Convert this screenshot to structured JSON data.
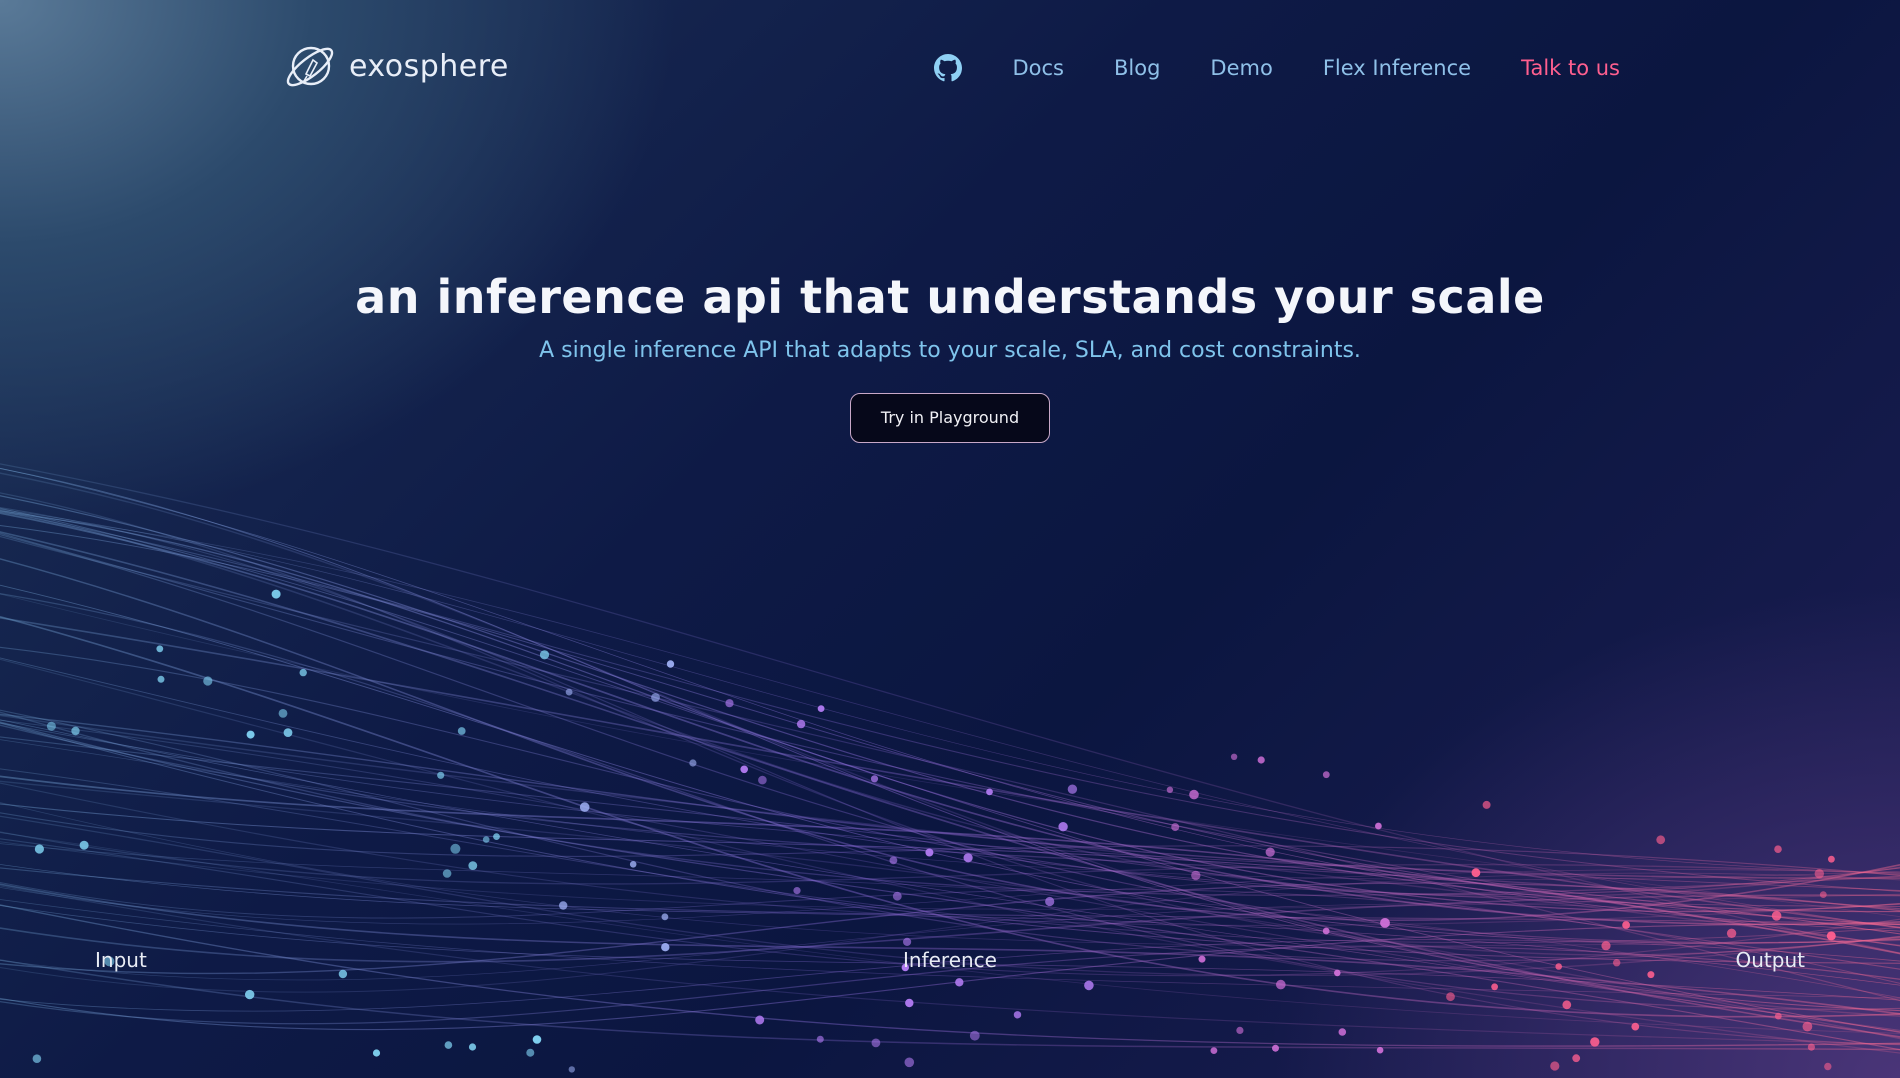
{
  "brand": {
    "name": "exosphere",
    "logo_icon": "planet-rocket-logo-icon"
  },
  "nav": {
    "github_icon": "github-icon",
    "items": [
      {
        "label": "Docs"
      },
      {
        "label": "Blog"
      },
      {
        "label": "Demo"
      },
      {
        "label": "Flex Inference"
      }
    ],
    "cta": "Talk to us"
  },
  "hero": {
    "title": "an inference api that understands your scale",
    "subtitle": "A single inference API that adapts to your scale, SLA, and cost constraints.",
    "button": "Try in Playground"
  },
  "stages": {
    "input": "Input",
    "inference": "Inference",
    "output": "Output"
  },
  "colors": {
    "accent_cyan": "#7fd0f0",
    "accent_purple": "#b07af0",
    "accent_pink": "#ff5f8f"
  }
}
